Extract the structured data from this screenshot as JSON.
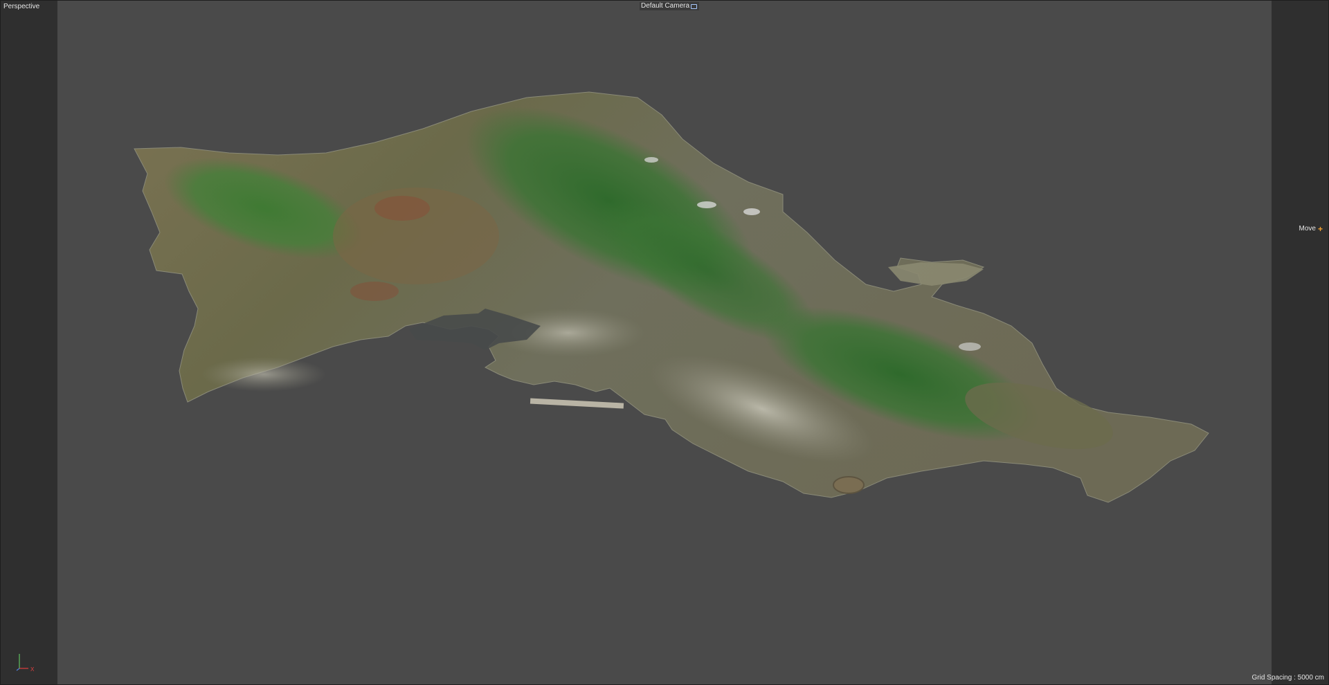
{
  "viewport": {
    "view_name": "Perspective",
    "camera_name": "Default Camera",
    "camera_icon": "camera-menu-icon",
    "tool_name": "Move",
    "tool_icon": "move-cross-icon",
    "grid_spacing": "Grid Spacing : 5000 cm"
  },
  "axis_gizmo": {
    "x_label": "X",
    "x_color": "#e04040",
    "y_color": "#60c060"
  },
  "scene": {
    "object": "island-terrain-mesh"
  },
  "colors": {
    "viewport_bg": "#4a4a4a",
    "safe_frame": "#2f2f2f",
    "accent_move": "#f0a030"
  }
}
